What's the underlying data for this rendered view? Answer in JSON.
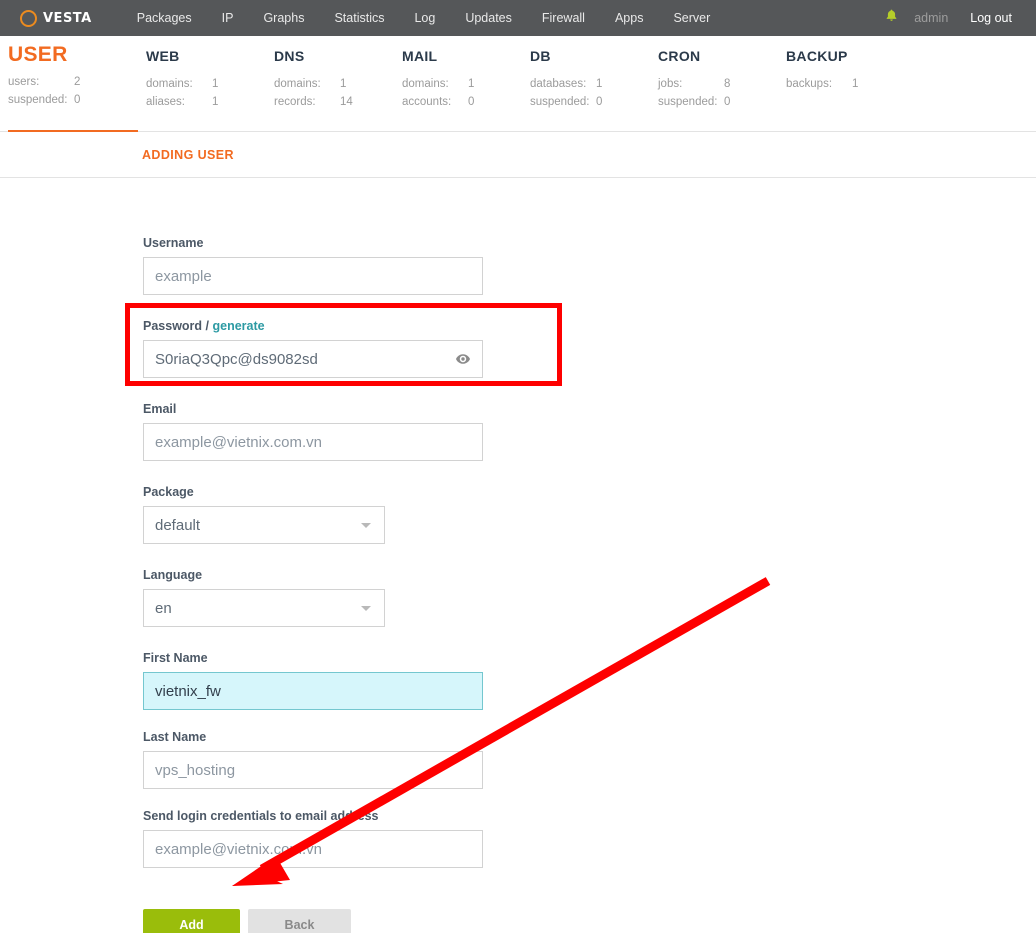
{
  "topnav": {
    "logo_text": "VESTA",
    "items": [
      {
        "label": "Packages"
      },
      {
        "label": "IP"
      },
      {
        "label": "Graphs"
      },
      {
        "label": "Statistics"
      },
      {
        "label": "Log"
      },
      {
        "label": "Updates"
      },
      {
        "label": "Firewall"
      },
      {
        "label": "Apps"
      },
      {
        "label": "Server"
      }
    ],
    "bell": "▲",
    "user": "admin",
    "logout": "Log out"
  },
  "stats": [
    {
      "title": "USER",
      "active": true,
      "rows": [
        {
          "key": "users:",
          "value": "2"
        },
        {
          "key": "suspended:",
          "value": "0"
        }
      ]
    },
    {
      "title": "WEB",
      "active": false,
      "rows": [
        {
          "key": "domains:",
          "value": "1"
        },
        {
          "key": "aliases:",
          "value": "1"
        }
      ]
    },
    {
      "title": "DNS",
      "active": false,
      "rows": [
        {
          "key": "domains:",
          "value": "1"
        },
        {
          "key": "records:",
          "value": "14"
        }
      ]
    },
    {
      "title": "MAIL",
      "active": false,
      "rows": [
        {
          "key": "domains:",
          "value": "1"
        },
        {
          "key": "accounts:",
          "value": "0"
        }
      ]
    },
    {
      "title": "DB",
      "active": false,
      "rows": [
        {
          "key": "databases:",
          "value": "1"
        },
        {
          "key": "suspended:",
          "value": "0"
        }
      ]
    },
    {
      "title": "CRON",
      "active": false,
      "rows": [
        {
          "key": "jobs:",
          "value": "8"
        },
        {
          "key": "suspended:",
          "value": "0"
        }
      ]
    },
    {
      "title": "BACKUP",
      "active": false,
      "rows": [
        {
          "key": "backups:",
          "value": "1"
        }
      ]
    }
  ],
  "section": {
    "title": "ADDING USER"
  },
  "form": {
    "username": {
      "label": "Username",
      "value": "",
      "placeholder": "example"
    },
    "password": {
      "label_main": "Password /",
      "label_link": "generate",
      "value": "S0riaQ3Qpc@ds9082sd",
      "placeholder": "",
      "eye_icon": "eye-icon"
    },
    "email": {
      "label": "Email",
      "value": "",
      "placeholder": "example@vietnix.com.vn"
    },
    "package": {
      "label": "Package",
      "value": "default",
      "options": [
        "default"
      ]
    },
    "language": {
      "label": "Language",
      "value": "en",
      "options": [
        "en"
      ]
    },
    "first_name": {
      "label": "First Name",
      "value": "vietnix_fw",
      "placeholder": "",
      "focused": true
    },
    "last_name": {
      "label": "Last Name",
      "value": "",
      "placeholder": "vps_hosting"
    },
    "send_credentials": {
      "label": "Send login credentials to email address",
      "value": "",
      "placeholder": "example@vietnix.com.vn"
    },
    "buttons": {
      "add": "Add",
      "back": "Back"
    }
  },
  "colors": {
    "brand_orange": "#f26b21",
    "topbar_gray": "#555759",
    "add_green": "#9abd0b",
    "annotation_red": "#fe0000",
    "link_teal": "#2c9aa3",
    "focus_cyan": "#d6f6fb"
  }
}
